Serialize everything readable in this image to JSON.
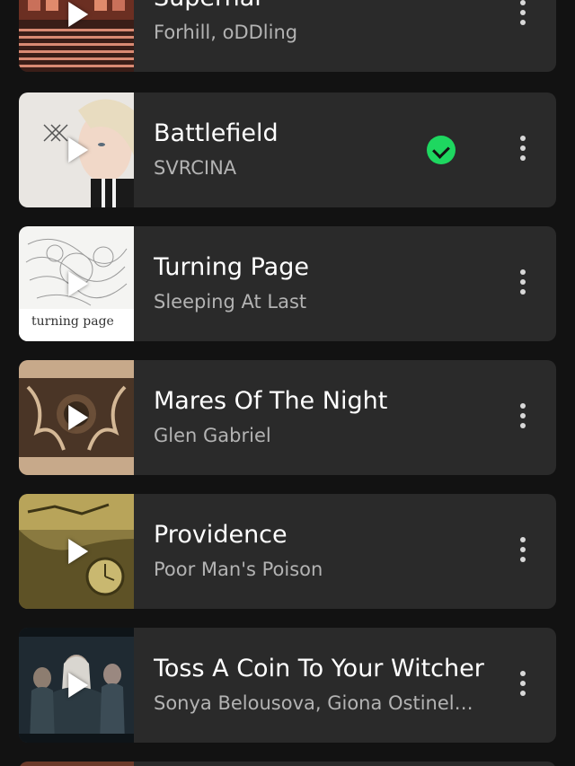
{
  "tracks": [
    {
      "title": "Supernal",
      "artist": "Forhill, oDDling",
      "downloaded": false,
      "cover": "supernal-cover"
    },
    {
      "title": "Battlefield",
      "artist": "SVRCINA",
      "downloaded": true,
      "cover": "battlefield-cover"
    },
    {
      "title": "Turning Page",
      "artist": "Sleeping At Last",
      "downloaded": false,
      "cover": "turning-page-cover",
      "cover_text": "turning page"
    },
    {
      "title": "Mares Of The Night",
      "artist": "Glen Gabriel",
      "downloaded": false,
      "cover": "mares-cover"
    },
    {
      "title": "Providence",
      "artist": "Poor Man's Poison",
      "downloaded": false,
      "cover": "providence-cover"
    },
    {
      "title": "Toss A Coin To Your Witcher",
      "artist": "Sonya Belousova, Giona Ostinelli...",
      "downloaded": false,
      "cover": "witcher-cover"
    }
  ],
  "colors": {
    "background": "#121212",
    "card": "#2a2a2a",
    "title": "#ffffff",
    "subtitle": "#b3b3b3",
    "accent": "#1ed760"
  },
  "icons": {
    "play": "play-icon",
    "more": "more-vertical-icon",
    "downloaded": "downloaded-check-icon"
  }
}
